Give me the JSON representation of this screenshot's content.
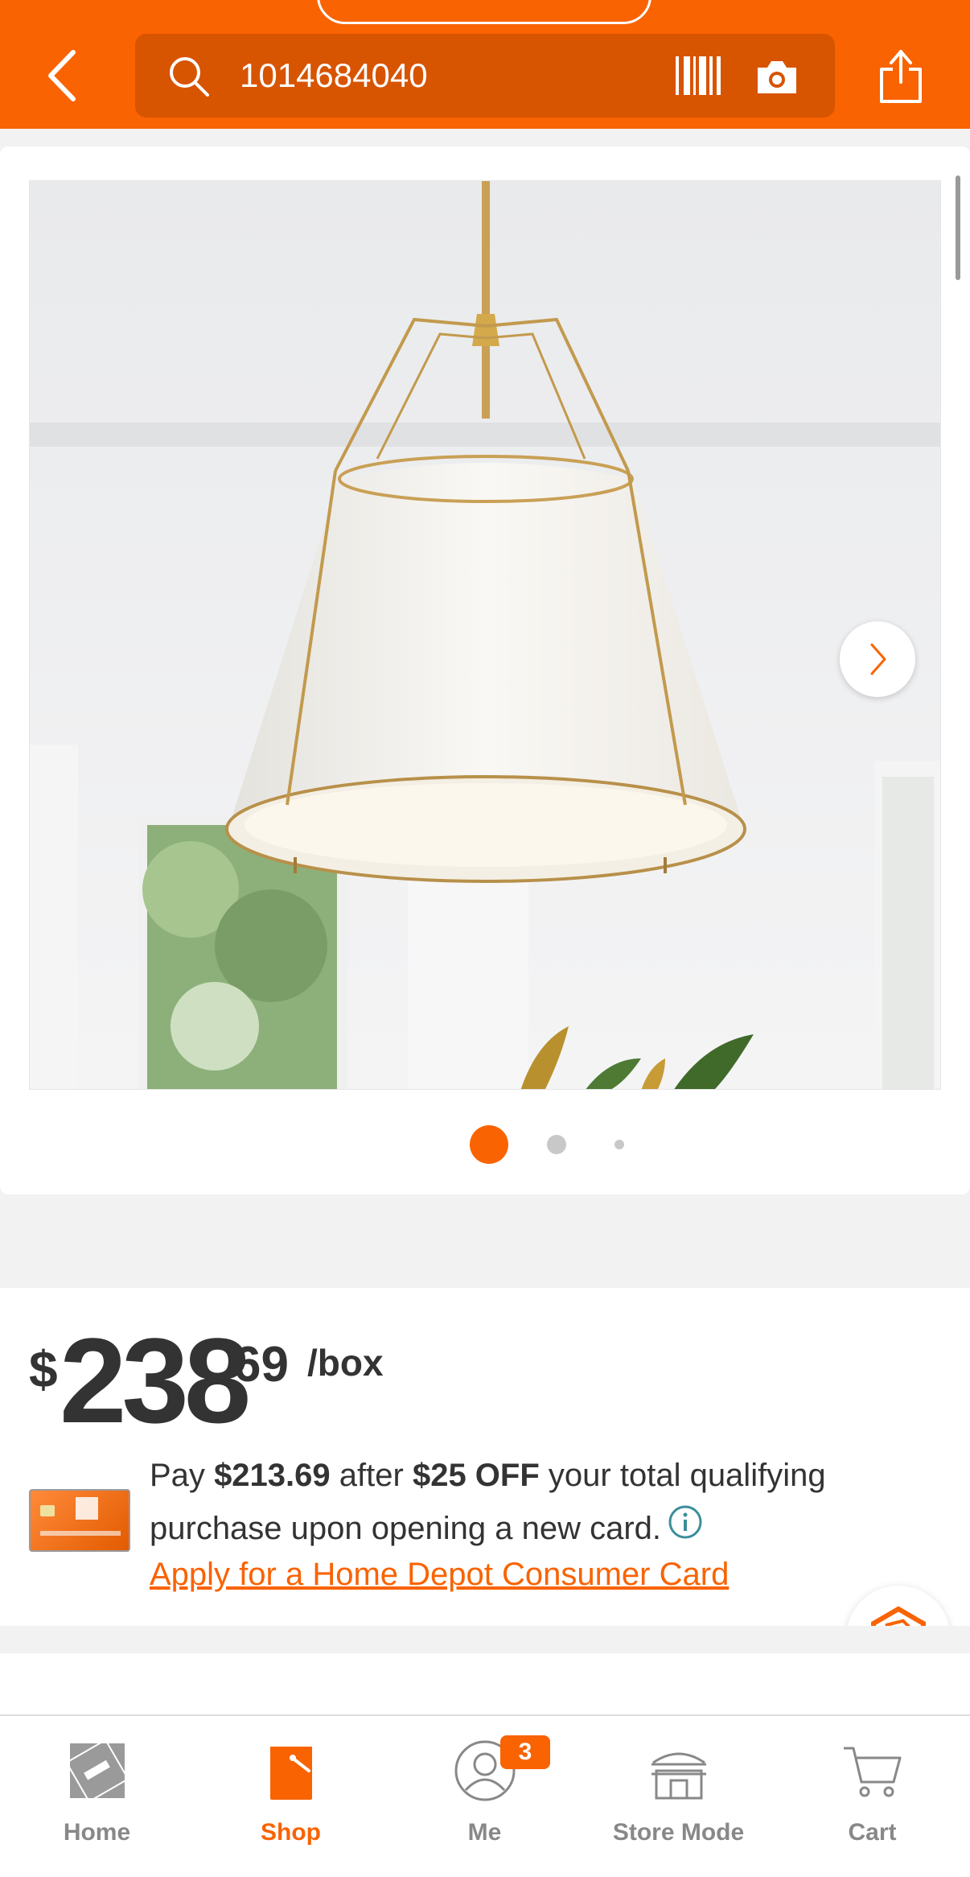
{
  "header": {
    "search_query": "1014684040",
    "accent_color": "#f96302",
    "icons": [
      "back-icon",
      "search-icon",
      "barcode-icon",
      "camera-icon",
      "share-icon"
    ]
  },
  "gallery": {
    "image_alt": "Gold and white fabric drum pendant light",
    "dots_count": 3,
    "active_dot": 0
  },
  "price": {
    "currency": "$",
    "dollars": "238",
    "cents": "69",
    "unit": "/box"
  },
  "promo": {
    "pay_label": "Pay",
    "discounted_price": "$213.69",
    "after_label": "after",
    "discount": "$25 OFF",
    "text_rest": "your total qualifying purchase upon opening a new card.",
    "apply_link": "Apply for a Home Depot Consumer Card"
  },
  "nav": {
    "items": [
      {
        "label": "Home",
        "icon": "home-depot-logo-icon"
      },
      {
        "label": "Shop",
        "icon": "shop-bag-icon"
      },
      {
        "label": "Me",
        "icon": "user-icon"
      },
      {
        "label": "Store Mode",
        "icon": "store-icon"
      },
      {
        "label": "Cart",
        "icon": "cart-icon"
      }
    ],
    "active": "Shop",
    "me_badge": "3"
  }
}
